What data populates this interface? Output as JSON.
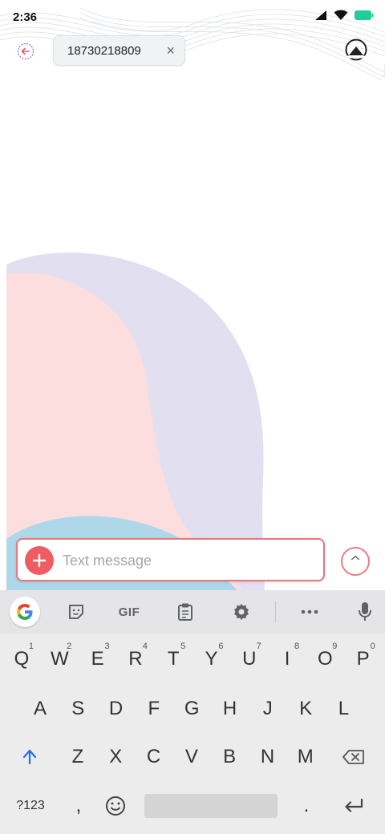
{
  "status_bar": {
    "time": "2:36"
  },
  "header": {
    "recipient_chip": {
      "number": "18730218809",
      "close_glyph": "×"
    }
  },
  "composer": {
    "placeholder": "Text message",
    "value": "",
    "send_glyph": "^"
  },
  "keyboard": {
    "toolbar": {
      "gif_label": "GIF"
    },
    "rows": [
      [
        {
          "label": "Q",
          "hint": "1"
        },
        {
          "label": "W",
          "hint": "2"
        },
        {
          "label": "E",
          "hint": "3"
        },
        {
          "label": "R",
          "hint": "4"
        },
        {
          "label": "T",
          "hint": "5"
        },
        {
          "label": "Y",
          "hint": "6"
        },
        {
          "label": "U",
          "hint": "7"
        },
        {
          "label": "I",
          "hint": "8"
        },
        {
          "label": "O",
          "hint": "9"
        },
        {
          "label": "P",
          "hint": "0"
        }
      ],
      [
        {
          "label": "A"
        },
        {
          "label": "S"
        },
        {
          "label": "D"
        },
        {
          "label": "F"
        },
        {
          "label": "G"
        },
        {
          "label": "H"
        },
        {
          "label": "J"
        },
        {
          "label": "K"
        },
        {
          "label": "L"
        }
      ],
      [
        {
          "label": "Z"
        },
        {
          "label": "X"
        },
        {
          "label": "C"
        },
        {
          "label": "V"
        },
        {
          "label": "B"
        },
        {
          "label": "N"
        },
        {
          "label": "M"
        }
      ]
    ],
    "bottom": {
      "symbols_label": "?123",
      "comma_label": ",",
      "period_label": "."
    }
  },
  "colors": {
    "accent": "#ef5d63",
    "blob_lavender": "#e2dff0",
    "blob_pink": "#fcdedf",
    "blob_blue": "#aed8ea",
    "keyboard_bg": "#ececec"
  }
}
